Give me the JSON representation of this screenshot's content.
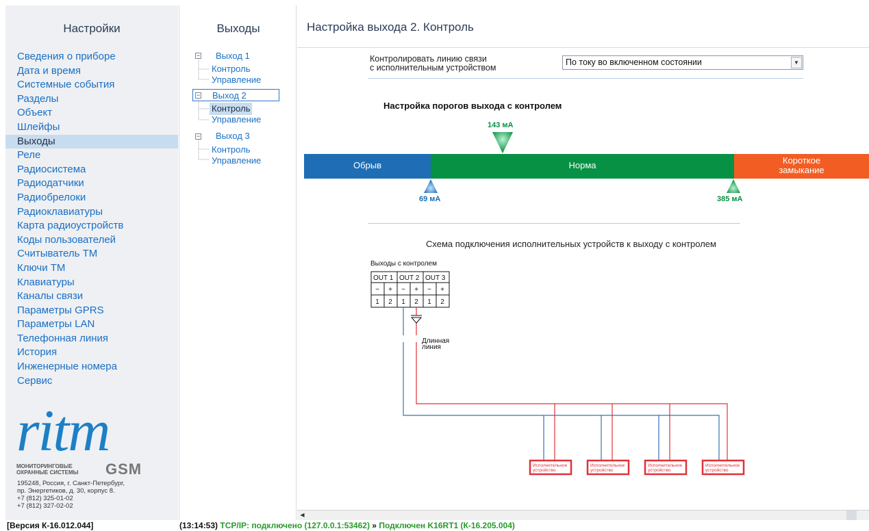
{
  "left_panel": {
    "title": "Настройки",
    "menu": [
      {
        "label": "Сведения о приборе",
        "selected": false
      },
      {
        "label": "Дата и время",
        "selected": false
      },
      {
        "label": "Системные события",
        "selected": false
      },
      {
        "label": "Разделы",
        "selected": false
      },
      {
        "label": "Объект",
        "selected": false
      },
      {
        "label": "Шлейфы",
        "selected": false
      },
      {
        "label": "Выходы",
        "selected": true
      },
      {
        "label": "Реле",
        "selected": false
      },
      {
        "label": "Радиосистема",
        "selected": false
      },
      {
        "label": "Радиодатчики",
        "selected": false
      },
      {
        "label": "Радиобрелоки",
        "selected": false
      },
      {
        "label": "Радиоклавиатуры",
        "selected": false
      },
      {
        "label": "Карта радиоустройств",
        "selected": false
      },
      {
        "label": "Коды пользователей",
        "selected": false
      },
      {
        "label": "Считыватель ТМ",
        "selected": false
      },
      {
        "label": "Ключи ТМ",
        "selected": false
      },
      {
        "label": "Клавиатуры",
        "selected": false
      },
      {
        "label": "Каналы связи",
        "selected": false
      },
      {
        "label": "Параметры GPRS",
        "selected": false
      },
      {
        "label": "Параметры LAN",
        "selected": false
      },
      {
        "label": "Телефонная линия",
        "selected": false
      },
      {
        "label": "История",
        "selected": false
      },
      {
        "label": "Инженерные номера",
        "selected": false
      },
      {
        "label": "Сервис",
        "selected": false
      }
    ],
    "logo": {
      "brand": "ritm",
      "line1": "МОНИТОРИНГОВЫЕ",
      "line2": "ОХРАННЫЕ СИСТЕМЫ",
      "gsm": "GSM"
    },
    "address": [
      "195248, Россия, г. Санкт-Петербург,",
      "пр. Энергетиков, д. 30, корпус 8.",
      "+7 (812) 325-01-02",
      "+7 (812) 327-02-02"
    ]
  },
  "tree_panel": {
    "title": "Выходы",
    "outputs": [
      {
        "label": "Выход 1",
        "children": [
          "Контроль",
          "Управление"
        ]
      },
      {
        "label": "Выход 2",
        "children": [
          "Контроль",
          "Управление"
        ]
      },
      {
        "label": "Выход 3",
        "children": [
          "Контроль",
          "Управление"
        ]
      }
    ]
  },
  "main": {
    "title": "Настройка выхода 2. Контроль",
    "control_label_line1": "Контролировать линию связи",
    "control_label_line2": "с исполнительным устройством",
    "control_select_value": "По току во включенном состоянии",
    "thresholds_title": "Настройка порогов выхода с контролем",
    "zones": {
      "open": "Обрыв",
      "normal": "Норма",
      "short_line1": "Короткое",
      "short_line2": "замыкание"
    },
    "markers": {
      "current": "143 мА",
      "low": "69 мА",
      "high": "385 мА"
    },
    "scheme_title": "Схема подключения исполнительных устройств к выходу с контролем",
    "scheme": {
      "header": "Выходы с контролем",
      "outs": [
        "OUT 1",
        "OUT 2",
        "OUT 3"
      ],
      "signs": [
        "−",
        "+",
        "−",
        "+",
        "−",
        "+"
      ],
      "pins": [
        "1",
        "2",
        "1",
        "2",
        "1",
        "2"
      ],
      "long_line_1": "Длинная",
      "long_line_2": "линия",
      "device_line1": "Исполнительное",
      "device_line2": "устройство"
    }
  },
  "statusbar": {
    "version": "[Версия К-16.012.044]",
    "time": "(13:14:53)",
    "connection": "TCP/IP: подключено (127.0.0.1:53462)",
    "sep": "»",
    "device": "Подключен K16RT1 (К-16.205.004)"
  },
  "colors": {
    "zone_open": "#1f6eb5",
    "zone_normal": "#069144",
    "zone_short": "#f25d24",
    "link": "#1a6fc4",
    "status_green": "#2a9a2a",
    "logo_blue": "#1d7fc6"
  }
}
